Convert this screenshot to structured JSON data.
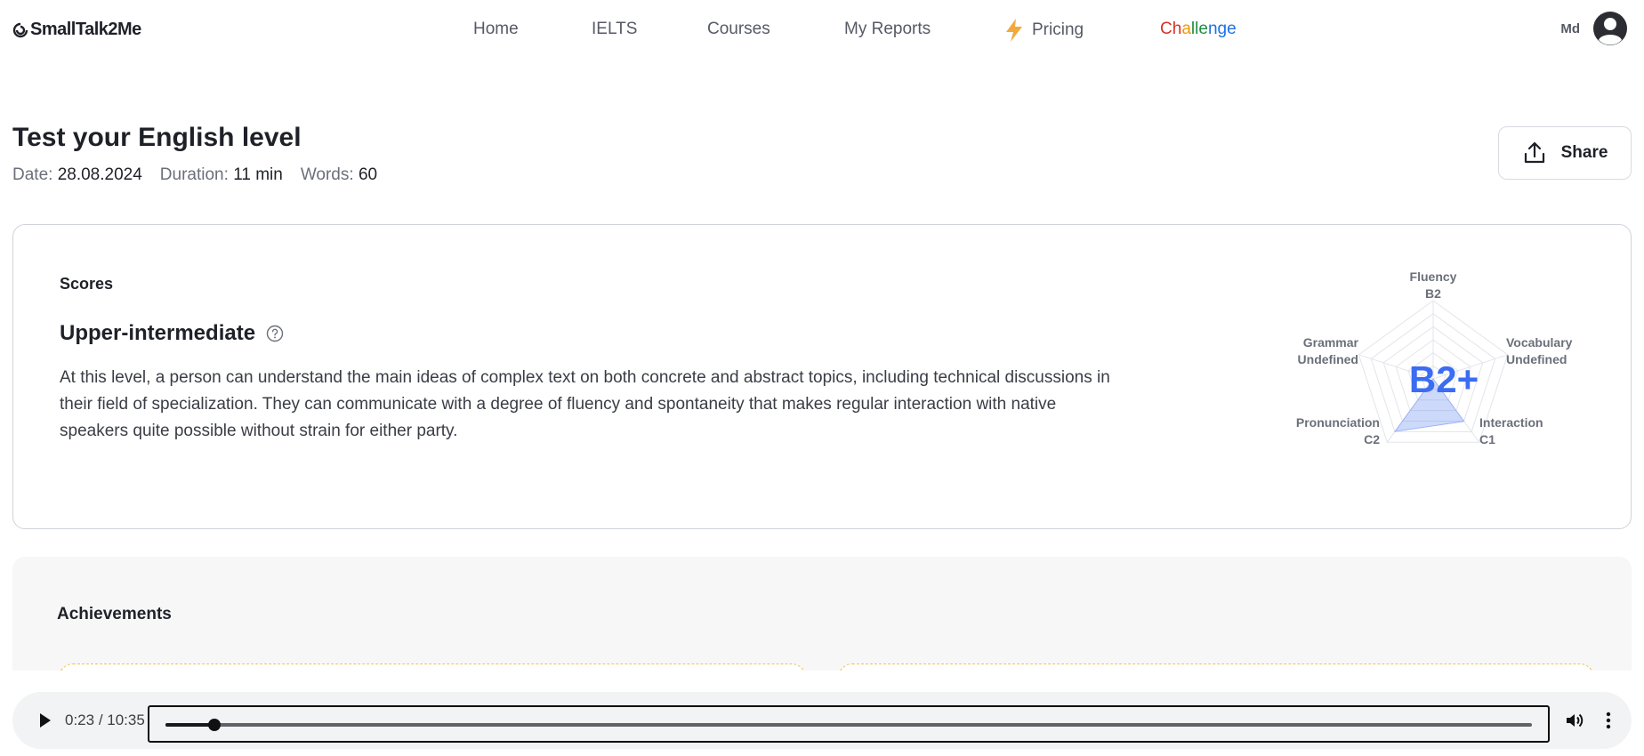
{
  "header": {
    "brand": "SmallTalk2Me",
    "nav": {
      "home": "Home",
      "ielts": "IELTS",
      "courses": "Courses",
      "reports": "My Reports",
      "pricing": "Pricing",
      "challenge": [
        "C",
        "h",
        "a",
        "l",
        "l",
        "e",
        "n",
        "g",
        "e"
      ]
    },
    "challenge_colors": [
      "#d93025",
      "#d93025",
      "#f29900",
      "#1e8e3e",
      "#1e8e3e",
      "#1e8e3e",
      "#1a73e8",
      "#1a73e8",
      "#1a73e8"
    ],
    "user_initials": "Md"
  },
  "test": {
    "title": "Test your English level",
    "date_label": "Date:",
    "date": "28.08.2024",
    "duration_label": "Duration:",
    "duration": "11 min",
    "words_label": "Words:",
    "words": "60",
    "share_label": "Share"
  },
  "scores": {
    "section_label": "Scores",
    "level_name": "Upper-intermediate",
    "description": "At this level, a person can understand the main ideas of complex text on both concrete and abstract topics, including technical discussions in their field of specialization. They can communicate with a degree of fluency and spontaneity that makes regular interaction with native speakers quite possible without strain for either party.",
    "overall": "B2+",
    "accent_color": "#3b6cf2"
  },
  "chart_data": {
    "type": "radar",
    "axes": [
      {
        "name": "Fluency",
        "level": "B2"
      },
      {
        "name": "Vocabulary",
        "level": "Undefined"
      },
      {
        "name": "Interaction",
        "level": "C1"
      },
      {
        "name": "Pronunciation",
        "level": "C2"
      },
      {
        "name": "Grammar",
        "level": "Undefined"
      }
    ],
    "values": [
      0,
      0,
      0.67,
      0.83,
      0
    ],
    "rings": 6,
    "center_label": "B2+"
  },
  "achievements": {
    "title": "Achievements"
  },
  "player": {
    "current": "0:23",
    "total": "10:35",
    "progress": 0.036
  }
}
